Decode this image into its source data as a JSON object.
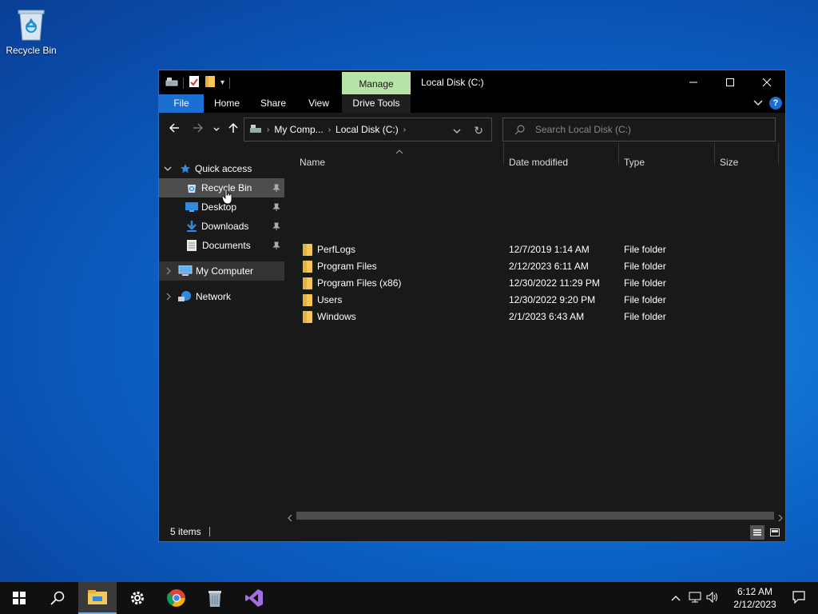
{
  "desktop": {
    "recycle_bin_label": "Recycle Bin"
  },
  "window": {
    "title": "Local Disk (C:)",
    "contextual_tab_group": "Manage",
    "ribbon_tabs": [
      "File",
      "Home",
      "Share",
      "View",
      "Drive Tools"
    ],
    "address": {
      "crumbs": [
        "My Comp...",
        "Local Disk (C:)"
      ]
    },
    "search_placeholder": "Search Local Disk (C:)"
  },
  "navpane": {
    "quick_access": "Quick access",
    "items": [
      {
        "label": "Recycle Bin",
        "icon": "recycle-bin-icon",
        "pinned": true
      },
      {
        "label": "Desktop",
        "icon": "desktop-icon",
        "pinned": true
      },
      {
        "label": "Downloads",
        "icon": "downloads-icon",
        "pinned": true
      },
      {
        "label": "Documents",
        "icon": "documents-icon",
        "pinned": true
      }
    ],
    "my_computer": "My Computer",
    "network": "Network"
  },
  "content": {
    "columns": [
      "Name",
      "Date modified",
      "Type",
      "Size"
    ],
    "rows": [
      {
        "name": "PerfLogs",
        "date": "12/7/2019 1:14 AM",
        "type": "File folder",
        "size": ""
      },
      {
        "name": "Program Files",
        "date": "2/12/2023 6:11 AM",
        "type": "File folder",
        "size": ""
      },
      {
        "name": "Program Files (x86)",
        "date": "12/30/2022 11:29 PM",
        "type": "File folder",
        "size": ""
      },
      {
        "name": "Users",
        "date": "12/30/2022 9:20 PM",
        "type": "File folder",
        "size": ""
      },
      {
        "name": "Windows",
        "date": "2/1/2023 6:43 AM",
        "type": "File folder",
        "size": ""
      }
    ]
  },
  "status": {
    "items": "5 items"
  },
  "taskbar": {
    "time": "6:12 AM",
    "date": "2/12/2023",
    "apps": [
      "start-icon",
      "search-icon",
      "file-explorer-icon",
      "settings-icon",
      "chrome-icon",
      "recycle-bin-icon",
      "visual-studio-icon"
    ]
  },
  "colors": {
    "accent": "#1a6fd1",
    "manage_tab": "#b8e3a7",
    "window_bg": "#191919"
  }
}
